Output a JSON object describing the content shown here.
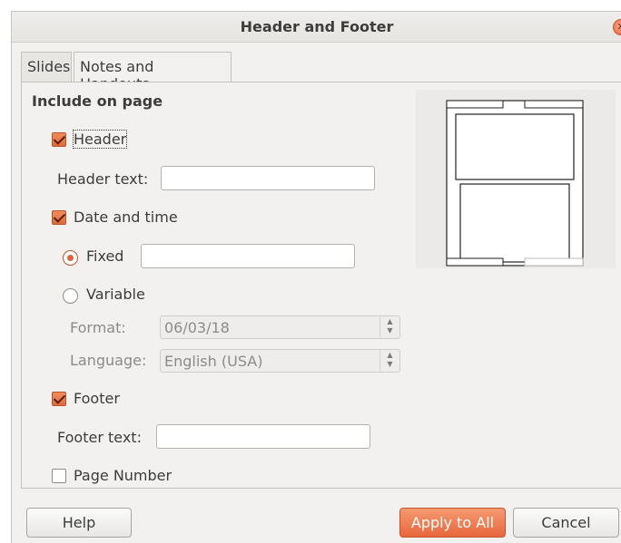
{
  "window": {
    "title": "Header and Footer"
  },
  "tabs": [
    {
      "label": "Slides",
      "active": false
    },
    {
      "label": "Notes and Handouts",
      "active": true
    }
  ],
  "include_on_page": {
    "title": "Include on page",
    "header": {
      "label": "Header",
      "checked": true
    },
    "header_text": {
      "label": "Header text:",
      "value": ""
    },
    "date_and_time": {
      "label": "Date and time",
      "checked": true
    },
    "fixed": {
      "label": "Fixed",
      "selected": true,
      "value": ""
    },
    "variable": {
      "label": "Variable",
      "selected": false
    },
    "format": {
      "label": "Format:",
      "value": "06/03/18",
      "enabled": false
    },
    "language": {
      "label": "Language:",
      "value": "English (USA)",
      "enabled": false
    },
    "footer": {
      "label": "Footer",
      "checked": true
    },
    "footer_text": {
      "label": "Footer text:",
      "value": ""
    },
    "page_number": {
      "label": "Page Number",
      "checked": false
    }
  },
  "buttons": {
    "help": "Help",
    "apply_to_all": "Apply to All",
    "cancel": "Cancel"
  },
  "icons": {
    "close": "close-icon",
    "spin_up": "chevron-up-icon",
    "spin_down": "chevron-down-icon"
  },
  "colors": {
    "accent": "#e8673d",
    "dialog_bg": "#f2f1f0",
    "text": "#3c3c3c"
  }
}
